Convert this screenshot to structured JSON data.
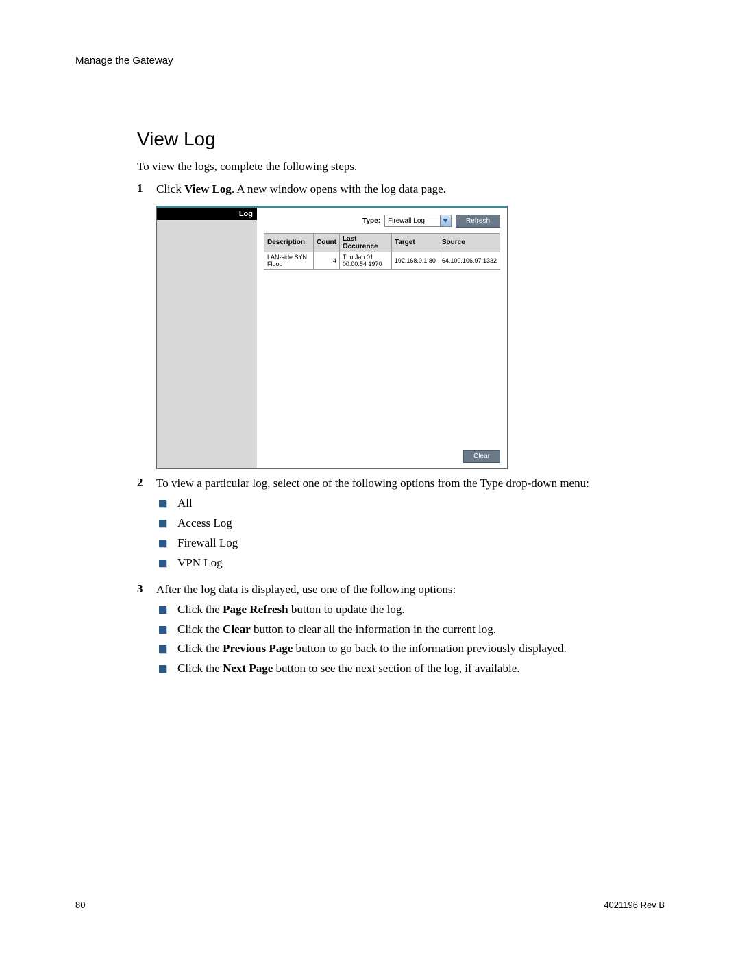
{
  "header": "Manage the Gateway",
  "title": "View Log",
  "intro": "To view the logs, complete the following steps.",
  "steps": {
    "s1": {
      "num": "1",
      "prefix": "Click ",
      "bold": "View Log",
      "suffix": ". A new window opens with the log data page."
    },
    "s2": {
      "num": "2",
      "text": "To view a particular log, select one of the following options from the Type drop-down menu:"
    },
    "s3": {
      "num": "3",
      "text": "After the log data is displayed, use one of the following options:"
    }
  },
  "screenshot": {
    "sidebar_header": "Log",
    "type_label": "Type:",
    "type_value": "Firewall Log",
    "refresh_label": "Refresh",
    "clear_label": "Clear",
    "table": {
      "headers": {
        "c0": "Description",
        "c1": "Count",
        "c2": "Last Occurence",
        "c3": "Target",
        "c4": "Source"
      },
      "row": {
        "desc": "LAN-side SYN Flood",
        "count": "4",
        "last": "Thu Jan 01 00:00:54 1970",
        "target": "192.168.0.1:80",
        "source": "64.100.106.97:1332"
      }
    }
  },
  "type_options": {
    "o0": "All",
    "o1": "Access Log",
    "o2": "Firewall Log",
    "o3": "VPN Log"
  },
  "actions": {
    "a0": {
      "pre": "Click the ",
      "b": "Page Refresh",
      "post": " button to update the log."
    },
    "a1": {
      "pre": "Click the ",
      "b": "Clear",
      "post": " button to clear all the information in the current log."
    },
    "a2": {
      "pre": "Click the ",
      "b": "Previous Page",
      "post": " button to go back to the information previously displayed."
    },
    "a3": {
      "pre": "Click the ",
      "b": "Next Page",
      "post": " button to see the next section of the log, if available."
    }
  },
  "footer": {
    "page_num": "80",
    "doc_id": "4021196 Rev B"
  }
}
